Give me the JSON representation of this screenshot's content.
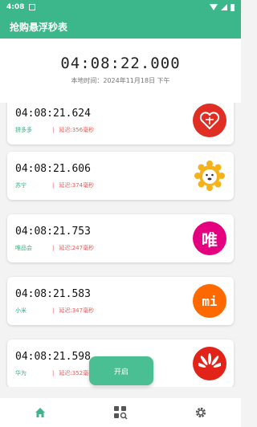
{
  "status_bar": {
    "time": "4:08"
  },
  "app": {
    "title": "抢购悬浮秒表"
  },
  "header": {
    "main_time": "04:08:22.000",
    "local_time": "本地时间：2024年11月18日 下午"
  },
  "items": [
    {
      "time": "04:08:21.624",
      "name": "拼多多",
      "delay": "延迟:356毫秒",
      "logo": "pinduoduo-logo",
      "color": "#e02e24"
    },
    {
      "time": "04:08:21.606",
      "name": "苏宁",
      "delay": "延迟:374毫秒",
      "logo": "suning-logo",
      "color": "#f5b21b"
    },
    {
      "time": "04:08:21.753",
      "name": "唯品会",
      "delay": "延迟:247毫秒",
      "logo": "vipshop-logo",
      "color": "#e4007f",
      "glyph": "唯"
    },
    {
      "time": "04:08:21.583",
      "name": "小米",
      "delay": "延迟:347毫秒",
      "logo": "xiaomi-logo",
      "color": "#ff6900",
      "glyph": "mi"
    },
    {
      "time": "04:08:21.598",
      "name": "华为",
      "delay": "延迟:352毫秒",
      "logo": "huawei-logo",
      "color": "#e2231a"
    }
  ],
  "fab": {
    "label": "开启"
  },
  "nav": {
    "items": [
      "home-icon",
      "apps-search-icon",
      "settings-icon"
    ],
    "active_color": "#3bb78b"
  }
}
